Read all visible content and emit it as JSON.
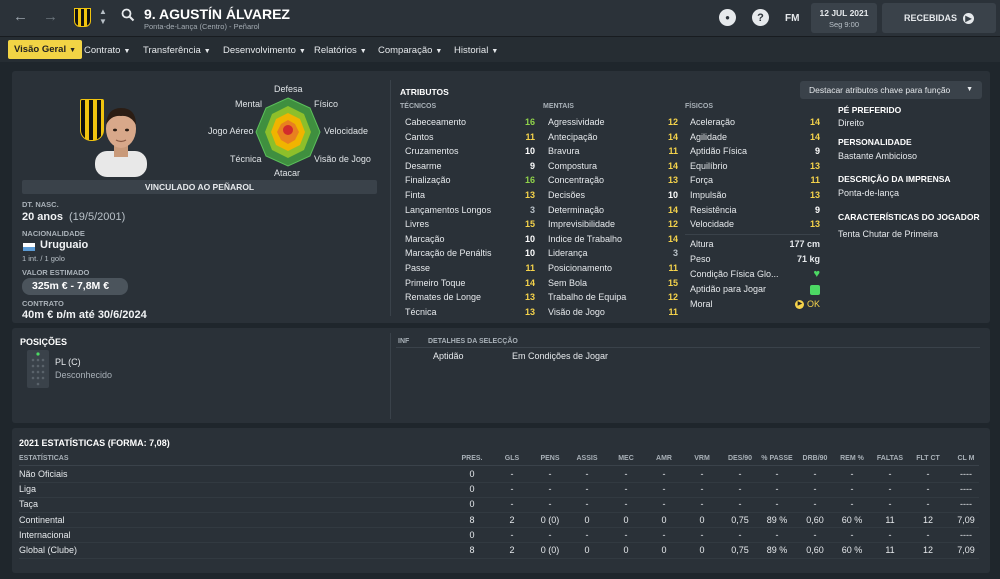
{
  "header": {
    "player_title": "9. AGUSTÍN ÁLVAREZ",
    "player_subtitle": "Ponta-de-Lança (Centro) - Peñarol",
    "fm_label": "FM",
    "date": "12 JUL 2021",
    "day_time": "Seg 9:00",
    "inbox_label": "RECEBIDAS",
    "help_glyph": "?"
  },
  "menu": {
    "items": [
      "Visão Geral",
      "Contrato",
      "Transferência",
      "Desenvolvimento",
      "Relatórios",
      "Comparação",
      "Historial"
    ],
    "active": "Visão Geral"
  },
  "profile": {
    "radar_labels": {
      "defesa": "Defesa",
      "fisico": "Físico",
      "mental": "Mental",
      "jogo_aereo": "Jogo Aéreo",
      "velocidade": "Velocidade",
      "tecnica": "Técnica",
      "visao": "Visão de Jogo",
      "ataque": "Atacar"
    },
    "contract_banner": "VINCULADO AO PEÑAROL",
    "dob_label": "DT. NASC.",
    "age": "20 anos",
    "dob": "(19/5/2001)",
    "nationality_label": "NACIONALIDADE",
    "nationality": "Uruguaio",
    "caps": "1 int. / 1 golo",
    "value_label": "VALOR ESTIMADO",
    "value": "325m € - 7,8M €",
    "contract_label": "CONTRATO",
    "contract": "40m € p/m até 30/6/2024"
  },
  "attributes": {
    "title": "ATRIBUTOS",
    "highlight_button": "Destacar atributos chave para função",
    "technical_header": "TÉCNICOS",
    "mental_header": "MENTAIS",
    "physical_header": "FÍSICOS",
    "technical": [
      {
        "name": "Cabeceamento",
        "value": "16",
        "tier": "green"
      },
      {
        "name": "Cantos",
        "value": "11",
        "tier": "yellow"
      },
      {
        "name": "Cruzamentos",
        "value": "10",
        "tier": "white"
      },
      {
        "name": "Desarme",
        "value": "9",
        "tier": "white"
      },
      {
        "name": "Finalização",
        "value": "16",
        "tier": "green"
      },
      {
        "name": "Finta",
        "value": "13",
        "tier": "yellow"
      },
      {
        "name": "Lançamentos Longos",
        "value": "3",
        "tier": "grey"
      },
      {
        "name": "Livres",
        "value": "15",
        "tier": "yellow"
      },
      {
        "name": "Marcação",
        "value": "10",
        "tier": "white"
      },
      {
        "name": "Marcação de Penáltis",
        "value": "10",
        "tier": "white"
      },
      {
        "name": "Passe",
        "value": "11",
        "tier": "yellow"
      },
      {
        "name": "Primeiro Toque",
        "value": "14",
        "tier": "yellow"
      },
      {
        "name": "Remates de Longe",
        "value": "13",
        "tier": "yellow"
      },
      {
        "name": "Técnica",
        "value": "13",
        "tier": "yellow"
      }
    ],
    "mental": [
      {
        "name": "Agressividade",
        "value": "12",
        "tier": "yellow"
      },
      {
        "name": "Antecipação",
        "value": "14",
        "tier": "yellow"
      },
      {
        "name": "Bravura",
        "value": "11",
        "tier": "yellow"
      },
      {
        "name": "Compostura",
        "value": "14",
        "tier": "yellow"
      },
      {
        "name": "Concentração",
        "value": "13",
        "tier": "yellow"
      },
      {
        "name": "Decisões",
        "value": "10",
        "tier": "white"
      },
      {
        "name": "Determinação",
        "value": "14",
        "tier": "yellow"
      },
      {
        "name": "Imprevisibilidade",
        "value": "12",
        "tier": "yellow"
      },
      {
        "name": "Indice de Trabalho",
        "value": "14",
        "tier": "yellow"
      },
      {
        "name": "Liderança",
        "value": "3",
        "tier": "grey"
      },
      {
        "name": "Posicionamento",
        "value": "11",
        "tier": "yellow"
      },
      {
        "name": "Sem Bola",
        "value": "15",
        "tier": "yellow"
      },
      {
        "name": "Trabalho de Equipa",
        "value": "12",
        "tier": "yellow"
      },
      {
        "name": "Visão de Jogo",
        "value": "11",
        "tier": "yellow"
      }
    ],
    "physical": [
      {
        "name": "Aceleração",
        "value": "14",
        "tier": "yellow"
      },
      {
        "name": "Agilidade",
        "value": "14",
        "tier": "yellow"
      },
      {
        "name": "Aptidão Física",
        "value": "9",
        "tier": "white"
      },
      {
        "name": "Equilíbrio",
        "value": "13",
        "tier": "yellow"
      },
      {
        "name": "Força",
        "value": "11",
        "tier": "yellow"
      },
      {
        "name": "Impulsão",
        "value": "13",
        "tier": "yellow"
      },
      {
        "name": "Resistência",
        "value": "9",
        "tier": "white"
      },
      {
        "name": "Velocidade",
        "value": "13",
        "tier": "yellow"
      }
    ],
    "height_label": "Altura",
    "height": "177 cm",
    "weight_label": "Peso",
    "weight": "71 kg",
    "condition_label": "Condição Física Glo...",
    "fitness_label": "Aptidão para Jogar",
    "morale_label": "Moral",
    "morale": "OK"
  },
  "side_info": {
    "foot_label": "PÉ PREFERIDO",
    "foot": "Direito",
    "personality_label": "PERSONALIDADE",
    "personality": "Bastante Ambicioso",
    "press_label": "DESCRIÇÃO DA IMPRENSA",
    "press": "Ponta-de-lança",
    "traits_label": "CARACTERÍSTICAS DO JOGADOR",
    "traits": "Tenta Chutar de Primeira"
  },
  "positions": {
    "title": "POSIÇÕES",
    "position": "PL (C)",
    "position_note": "Desconhecido",
    "inf_label": "INF",
    "details_label": "DETALHES DA SELECÇÃO",
    "aptitude_label": "Aptidão",
    "aptitude": "Em Condições de Jogar"
  },
  "stats": {
    "title": "2021 ESTATÍSTICAS (FORMA: 7,08)",
    "col0": "ESTATÍSTICAS",
    "columns": [
      "PRES.",
      "GLS",
      "PENS",
      "ASSIS",
      "MEC",
      "AMR",
      "VRM",
      "DES/90",
      "% PASSE",
      "DRB/90",
      "REM %",
      "FALTAS",
      "FLT CT",
      "CL M"
    ],
    "rows": [
      {
        "label": "Não Oficiais",
        "cells": [
          "0",
          "-",
          "-",
          "-",
          "-",
          "-",
          "-",
          "-",
          "-",
          "-",
          "-",
          "-",
          "-",
          "----"
        ]
      },
      {
        "label": "Liga",
        "cells": [
          "0",
          "-",
          "-",
          "-",
          "-",
          "-",
          "-",
          "-",
          "-",
          "-",
          "-",
          "-",
          "-",
          "----"
        ]
      },
      {
        "label": "Taça",
        "cells": [
          "0",
          "-",
          "-",
          "-",
          "-",
          "-",
          "-",
          "-",
          "-",
          "-",
          "-",
          "-",
          "-",
          "----"
        ]
      },
      {
        "label": "Continental",
        "cells": [
          "8",
          "2",
          "0 (0)",
          "0",
          "0",
          "0",
          "0",
          "0,75",
          "89 %",
          "0,60",
          "60 %",
          "11",
          "12",
          "7,09"
        ]
      },
      {
        "label": "Internacional",
        "cells": [
          "0",
          "-",
          "-",
          "-",
          "-",
          "-",
          "-",
          "-",
          "-",
          "-",
          "-",
          "-",
          "-",
          "----"
        ]
      },
      {
        "label": "Global (Clube)",
        "cells": [
          "8",
          "2",
          "0 (0)",
          "0",
          "0",
          "0",
          "0",
          "0,75",
          "89 %",
          "0,60",
          "60 %",
          "11",
          "12",
          "7,09"
        ]
      }
    ]
  },
  "colors": {
    "accent": "#f2d445",
    "green": "#8fd24a",
    "yellow": "#f5d34b"
  }
}
